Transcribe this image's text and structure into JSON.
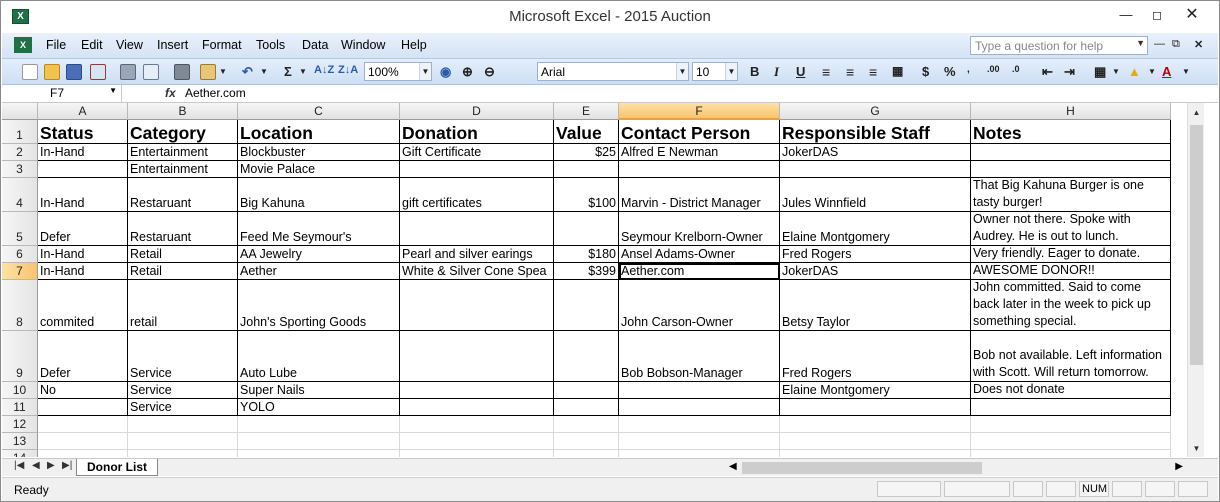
{
  "window": {
    "title": "Microsoft Excel - 2015 Auction",
    "app_icon": "excel-icon",
    "controls": [
      "minimize-icon",
      "maximize-icon",
      "close-icon"
    ]
  },
  "menu": {
    "items": [
      "File",
      "Edit",
      "View",
      "Insert",
      "Format",
      "Tools",
      "Data",
      "Window",
      "Help"
    ],
    "help_placeholder": "Type a question for help"
  },
  "toolbar": {
    "zoom": "100%",
    "font": "Arial",
    "font_size": "10",
    "bold": "B",
    "italic": "I",
    "underline": "U",
    "currency": "$",
    "percent": "%",
    "sum": "Σ"
  },
  "formula_bar": {
    "name_box": "F7",
    "fx": "fx",
    "value": "Aether.com"
  },
  "sheet": {
    "columns": [
      "A",
      "B",
      "C",
      "D",
      "E",
      "F",
      "G",
      "H"
    ],
    "selected_column": "F",
    "selected_row": "7",
    "header": [
      "Status",
      "Category",
      "Location",
      "Donation",
      "Value",
      "Contact Person",
      "Responsible Staff",
      "Notes"
    ],
    "rows": [
      {
        "n": "2",
        "cells": [
          "In-Hand",
          "Entertainment",
          "Blockbuster",
          "Gift Certificate",
          "$25",
          "Alfred E Newman",
          "JokerDAS",
          ""
        ]
      },
      {
        "n": "3",
        "cells": [
          "",
          "Entertainment",
          "Movie Palace",
          "",
          "",
          "",
          "",
          ""
        ]
      },
      {
        "n": "4",
        "cells": [
          "In-Hand",
          "Restaruant",
          "Big Kahuna",
          "gift certificates",
          "$100",
          "Marvin - District Manager",
          "Jules Winnfield",
          "That Big Kahuna Burger is one tasty burger!"
        ]
      },
      {
        "n": "5",
        "cells": [
          "Defer",
          "Restaruant",
          "Feed Me Seymour's",
          "",
          "",
          "Seymour Krelborn-Owner",
          "Elaine Montgomery",
          "Owner not there. Spoke with Audrey. He is out to lunch."
        ]
      },
      {
        "n": "6",
        "cells": [
          "In-Hand",
          "Retail",
          "AA Jewelry",
          "Pearl and silver earings",
          "$180",
          "Ansel Adams-Owner",
          "Fred Rogers",
          "Very friendly. Eager to donate."
        ]
      },
      {
        "n": "7",
        "cells": [
          "In-Hand",
          "Retail",
          "Aether",
          "White & Silver Cone Spea",
          "$399",
          "Aether.com",
          "JokerDAS",
          "AWESOME DONOR!!"
        ]
      },
      {
        "n": "8",
        "cells": [
          "commited",
          "retail",
          "John's Sporting Goods",
          "",
          "",
          "John Carson-Owner",
          "Betsy Taylor",
          "John committed. Said to come back later in the week to pick up something special."
        ]
      },
      {
        "n": "9",
        "cells": [
          "Defer",
          "Service",
          "Auto Lube",
          "",
          "",
          "Bob Bobson-Manager",
          "Fred Rogers",
          "Bob not available. Left information with Scott. Will return tomorrow."
        ]
      },
      {
        "n": "10",
        "cells": [
          "No",
          "Service",
          "Super Nails",
          "",
          "",
          "",
          "Elaine Montgomery",
          "Does not donate"
        ]
      },
      {
        "n": "11",
        "cells": [
          "",
          "Service",
          "YOLO",
          "",
          "",
          "",
          "",
          ""
        ]
      }
    ],
    "empty_rows": [
      "12",
      "13",
      "14"
    ]
  },
  "tabs": {
    "sheet_name": "Donor List"
  },
  "status": {
    "ready": "Ready",
    "num": "NUM"
  }
}
